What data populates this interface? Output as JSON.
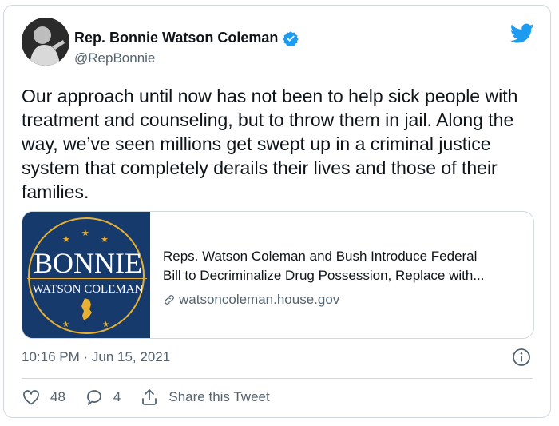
{
  "author": {
    "display_name": "Rep. Bonnie Watson Coleman",
    "handle": "@RepBonnie"
  },
  "tweet": {
    "text": "Our approach until now has not been to help sick people with treatment and counseling, but to throw them in jail. Along the way, we’ve seen millions get swept up in a criminal justice system that completely derails their lives and those of their families.",
    "timestamp": "10:16 PM · Jun 15, 2021"
  },
  "link_card": {
    "image_line1": "BONNIE",
    "image_line2": "WATSON COLEMAN",
    "title": "Reps. Watson Coleman and Bush Introduce Federal Bill to Decriminalize Drug Possession, Replace with...",
    "title_line1": "Reps. Watson Coleman and Bush Introduce Federal",
    "title_line2": "Bill to Decriminalize Drug Possession, Replace with...",
    "domain": "watsoncoleman.house.gov"
  },
  "actions": {
    "likes": "48",
    "replies": "4",
    "share_label": "Share this Tweet"
  },
  "icons": {
    "brand": "twitter-bird-icon",
    "verified": "verified-badge-icon",
    "info": "info-icon",
    "like": "heart-icon",
    "reply": "reply-icon",
    "share": "share-icon",
    "link": "link-icon"
  },
  "colors": {
    "brand_blue": "#1d9bf0",
    "text_primary": "#0f1419",
    "text_secondary": "#536471",
    "border": "#cfd9de",
    "card_navy": "#163a6b",
    "card_gold": "#e8b033"
  }
}
